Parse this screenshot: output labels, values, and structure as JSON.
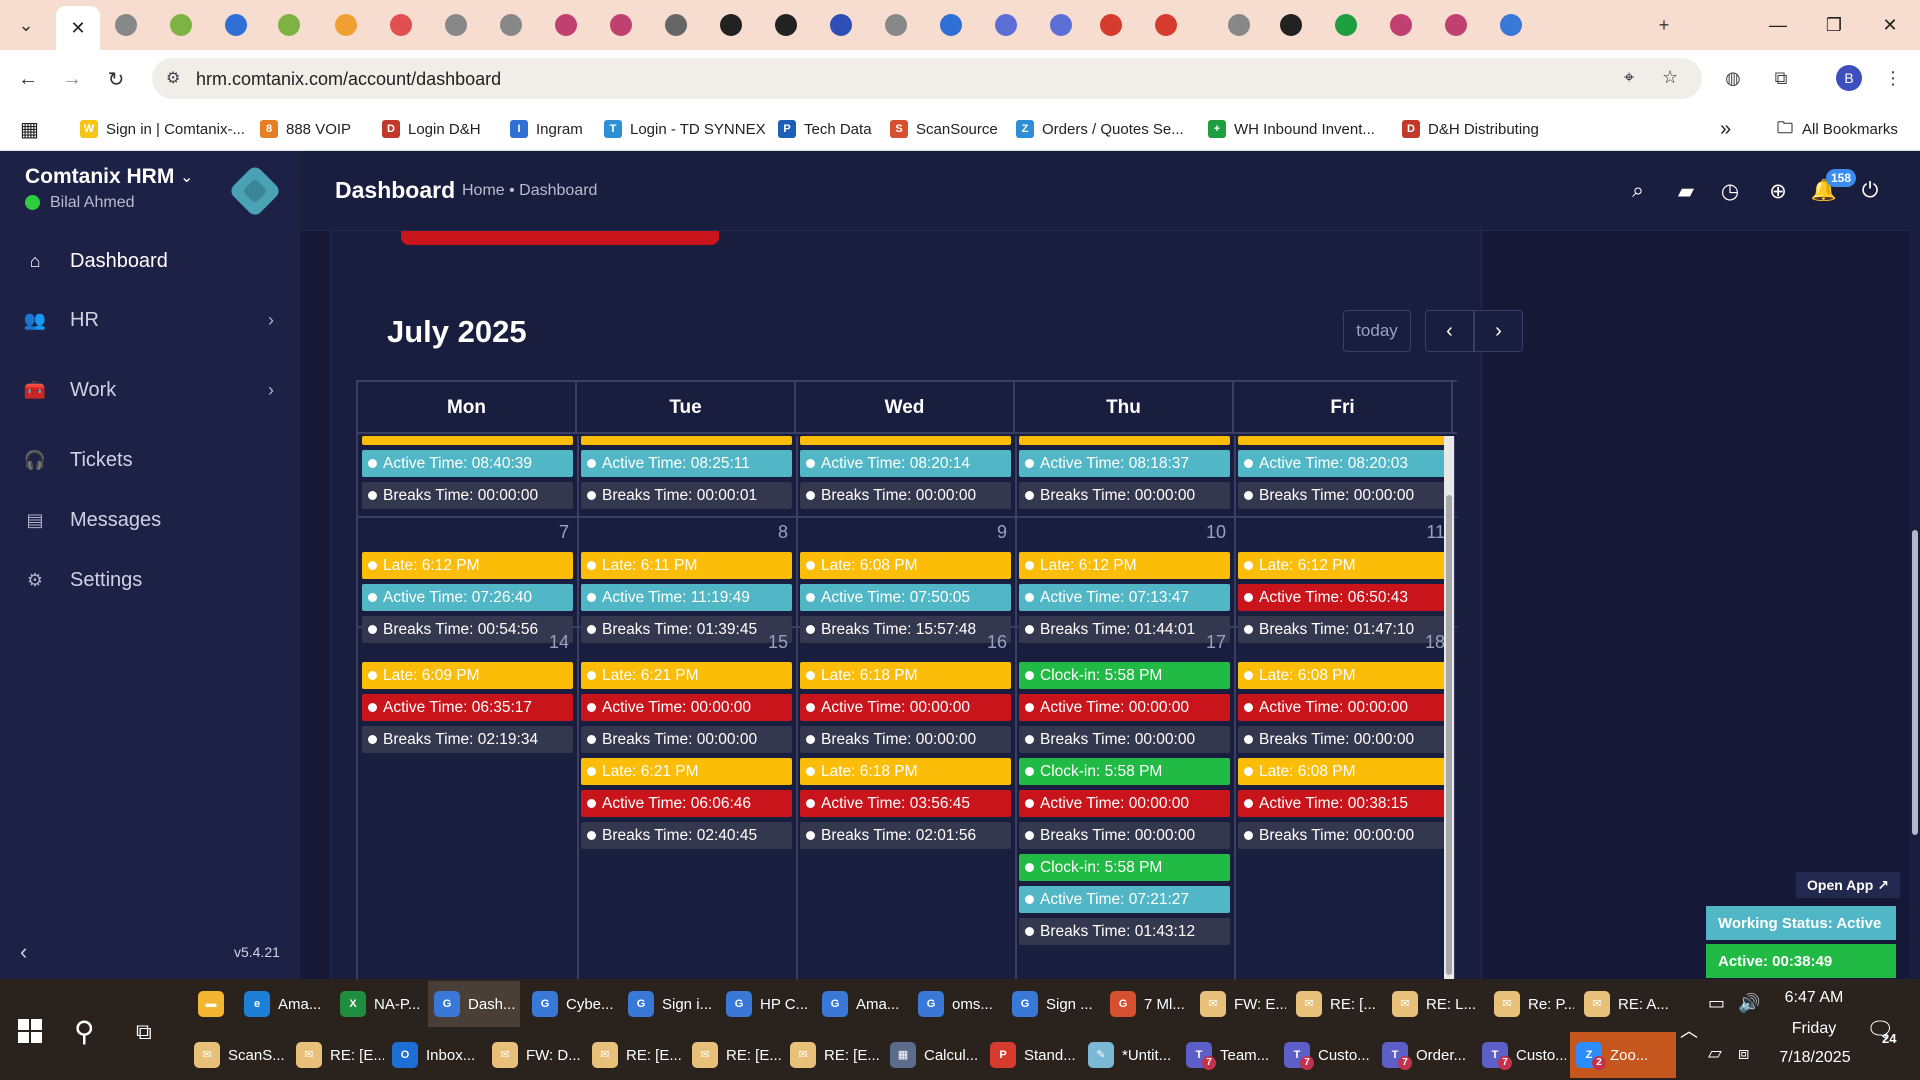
{
  "browser": {
    "url": "hrm.comtanix.com/account/dashboard",
    "tab_close": "✕",
    "new_tab": "+",
    "bookmarks": [
      {
        "label": "Sign in | Comtanix-...",
        "color": "#f5c518",
        "glyph": "W"
      },
      {
        "label": "888 VOIP",
        "color": "#e67e22",
        "glyph": "8"
      },
      {
        "label": "Login D&H",
        "color": "#c0392b",
        "glyph": "D"
      },
      {
        "label": "Ingram",
        "color": "#2f6fd6",
        "glyph": "I"
      },
      {
        "label": "Login - TD SYNNEX",
        "color": "#2f8fd6",
        "glyph": "T"
      },
      {
        "label": "Tech Data",
        "color": "#1b5fb8",
        "glyph": "P"
      },
      {
        "label": "ScanSource",
        "color": "#d64f2f",
        "glyph": "S"
      },
      {
        "label": "Orders / Quotes Se...",
        "color": "#2f8fd6",
        "glyph": "Z"
      },
      {
        "label": "WH Inbound Invent...",
        "color": "#1e9e3e",
        "glyph": "+"
      },
      {
        "label": "D&H Distributing",
        "color": "#c0392b",
        "glyph": "D"
      }
    ],
    "more_bookmarks": "»",
    "all_bookmarks": "All Bookmarks",
    "profile_initial": "B"
  },
  "app": {
    "brand": "Comtanix HRM",
    "user": "Bilal Ahmed",
    "nav": [
      {
        "label": "Dashboard",
        "icon": "⌂",
        "chevron": ""
      },
      {
        "label": "HR",
        "icon": "👥",
        "chevron": "›"
      },
      {
        "label": "Work",
        "icon": "🧰",
        "chevron": "›"
      },
      {
        "label": "Tickets",
        "icon": "🎧",
        "chevron": ""
      },
      {
        "label": "Messages",
        "icon": "▤",
        "chevron": ""
      },
      {
        "label": "Settings",
        "icon": "⚙",
        "chevron": ""
      }
    ],
    "version": "v5.4.21",
    "page_title": "Dashboard",
    "breadcrumb": "Home • Dashboard",
    "notification_count": "158"
  },
  "calendar": {
    "title": "July 2025",
    "today": "today",
    "prev": "‹",
    "next": "›",
    "days": [
      "Mon",
      "Tue",
      "Wed",
      "Thu",
      "Fri"
    ],
    "week1": {
      "events": [
        [
          {
            "t": "active",
            "text": "Active Time: 08:40:39"
          },
          {
            "t": "breaks",
            "text": "Breaks Time: 00:00:00"
          }
        ],
        [
          {
            "t": "active",
            "text": "Active Time: 08:25:11"
          },
          {
            "t": "breaks",
            "text": "Breaks Time: 00:00:01"
          }
        ],
        [
          {
            "t": "active",
            "text": "Active Time: 08:20:14"
          },
          {
            "t": "breaks",
            "text": "Breaks Time: 00:00:00"
          }
        ],
        [
          {
            "t": "active",
            "text": "Active Time: 08:18:37"
          },
          {
            "t": "breaks",
            "text": "Breaks Time: 00:00:00"
          }
        ],
        [
          {
            "t": "active",
            "text": "Active Time: 08:20:03"
          },
          {
            "t": "breaks",
            "text": "Breaks Time: 00:00:00"
          }
        ]
      ]
    },
    "week2": {
      "dates": [
        "7",
        "8",
        "9",
        "10",
        "11"
      ],
      "events": [
        [
          {
            "t": "late",
            "text": "Late: 6:12 PM"
          },
          {
            "t": "active",
            "text": "Active Time: 07:26:40"
          },
          {
            "t": "breaks",
            "text": "Breaks Time: 00:54:56"
          }
        ],
        [
          {
            "t": "late",
            "text": "Late: 6:11 PM"
          },
          {
            "t": "active",
            "text": "Active Time: 11:19:49"
          },
          {
            "t": "breaks",
            "text": "Breaks Time: 01:39:45"
          }
        ],
        [
          {
            "t": "late",
            "text": "Late: 6:08 PM"
          },
          {
            "t": "active",
            "text": "Active Time: 07:50:05"
          },
          {
            "t": "breaks",
            "text": "Breaks Time: 15:57:48"
          }
        ],
        [
          {
            "t": "late",
            "text": "Late: 6:12 PM"
          },
          {
            "t": "active",
            "text": "Active Time: 07:13:47"
          },
          {
            "t": "breaks",
            "text": "Breaks Time: 01:44:01"
          }
        ],
        [
          {
            "t": "late",
            "text": "Late: 6:12 PM"
          },
          {
            "t": "alert",
            "text": "Active Time: 06:50:43"
          },
          {
            "t": "breaks",
            "text": "Breaks Time: 01:47:10"
          }
        ]
      ]
    },
    "week3": {
      "dates": [
        "14",
        "15",
        "16",
        "17",
        "18"
      ],
      "events": [
        [
          {
            "t": "late",
            "text": "Late: 6:09 PM"
          },
          {
            "t": "alert",
            "text": "Active Time: 06:35:17"
          },
          {
            "t": "breaks",
            "text": "Breaks Time: 02:19:34"
          }
        ],
        [
          {
            "t": "late",
            "text": "Late: 6:21 PM"
          },
          {
            "t": "alert",
            "text": "Active Time: 00:00:00"
          },
          {
            "t": "breaks",
            "text": "Breaks Time: 00:00:00"
          },
          {
            "t": "late",
            "text": "Late: 6:21 PM"
          },
          {
            "t": "alert",
            "text": "Active Time: 06:06:46"
          },
          {
            "t": "breaks",
            "text": "Breaks Time: 02:40:45"
          }
        ],
        [
          {
            "t": "late",
            "text": "Late: 6:18 PM"
          },
          {
            "t": "alert",
            "text": "Active Time: 00:00:00"
          },
          {
            "t": "breaks",
            "text": "Breaks Time: 00:00:00"
          },
          {
            "t": "late",
            "text": "Late: 6:18 PM"
          },
          {
            "t": "alert",
            "text": "Active Time: 03:56:45"
          },
          {
            "t": "breaks",
            "text": "Breaks Time: 02:01:56"
          }
        ],
        [
          {
            "t": "clock",
            "text": "Clock-in: 5:58 PM"
          },
          {
            "t": "alert",
            "text": "Active Time: 00:00:00"
          },
          {
            "t": "breaks",
            "text": "Breaks Time: 00:00:00"
          },
          {
            "t": "clock",
            "text": "Clock-in: 5:58 PM"
          },
          {
            "t": "alert",
            "text": "Active Time: 00:00:00"
          },
          {
            "t": "breaks",
            "text": "Breaks Time: 00:00:00"
          },
          {
            "t": "clock",
            "text": "Clock-in: 5:58 PM"
          },
          {
            "t": "active",
            "text": "Active Time: 07:21:27"
          },
          {
            "t": "breaks",
            "text": "Breaks Time: 01:43:12"
          }
        ],
        [
          {
            "t": "late",
            "text": "Late: 6:08 PM"
          },
          {
            "t": "alert",
            "text": "Active Time: 00:00:00"
          },
          {
            "t": "breaks",
            "text": "Breaks Time: 00:00:00"
          },
          {
            "t": "late",
            "text": "Late: 6:08 PM"
          },
          {
            "t": "alert",
            "text": "Active Time: 00:38:15"
          },
          {
            "t": "breaks",
            "text": "Breaks Time: 00:00:00"
          }
        ]
      ]
    }
  },
  "status": {
    "open_app": "Open App ↗",
    "working": "Working Status: Active",
    "active": "Active: 00:38:49"
  },
  "taskbar": {
    "row1": [
      {
        "label": "",
        "color": "#f2b632",
        "glyph": "▬"
      },
      {
        "label": "Ama...",
        "color": "#1d7fd6",
        "glyph": "e"
      },
      {
        "label": "NA-P...",
        "color": "#1e8e3e",
        "glyph": "X"
      },
      {
        "label": "Dash...",
        "color": "#3a78d8",
        "glyph": "G"
      },
      {
        "label": "Cybe...",
        "color": "#3a78d8",
        "glyph": "G"
      },
      {
        "label": "Sign i...",
        "color": "#3a78d8",
        "glyph": "G"
      },
      {
        "label": "HP C...",
        "color": "#3a78d8",
        "glyph": "G"
      },
      {
        "label": "Ama...",
        "color": "#3a78d8",
        "glyph": "G"
      },
      {
        "label": "oms...",
        "color": "#3a78d8",
        "glyph": "G"
      },
      {
        "label": "Sign ...",
        "color": "#3a78d8",
        "glyph": "G"
      },
      {
        "label": "7 Ml...",
        "color": "#d64f2f",
        "glyph": "G"
      },
      {
        "label": "FW: E...",
        "color": "#e8c07a",
        "glyph": "✉"
      },
      {
        "label": "RE: [...",
        "color": "#e8c07a",
        "glyph": "✉"
      },
      {
        "label": "RE: L...",
        "color": "#e8c07a",
        "glyph": "✉"
      },
      {
        "label": "Re: P...",
        "color": "#e8c07a",
        "glyph": "✉"
      },
      {
        "label": "RE: A...",
        "color": "#e8c07a",
        "glyph": "✉"
      }
    ],
    "row2": [
      {
        "label": "ScanS...",
        "color": "#e8c07a",
        "glyph": "✉"
      },
      {
        "label": "RE: [E...",
        "color": "#e8c07a",
        "glyph": "✉"
      },
      {
        "label": "Inbox...",
        "color": "#1d6fd6",
        "glyph": "O"
      },
      {
        "label": "FW: D...",
        "color": "#e8c07a",
        "glyph": "✉"
      },
      {
        "label": "RE: [E...",
        "color": "#e8c07a",
        "glyph": "✉"
      },
      {
        "label": "RE: [E...",
        "color": "#e8c07a",
        "glyph": "✉"
      },
      {
        "label": "RE: [E...",
        "color": "#e8c07a",
        "glyph": "✉"
      },
      {
        "label": "Calcul...",
        "color": "#5b6b8c",
        "glyph": "▦"
      },
      {
        "label": "Stand...",
        "color": "#d63b2f",
        "glyph": "P"
      },
      {
        "label": "*Untit...",
        "color": "#7ab8d6",
        "glyph": "✎"
      },
      {
        "label": "Team...",
        "color": "#5b5fc7",
        "glyph": "T"
      },
      {
        "label": "Custo...",
        "color": "#5b5fc7",
        "glyph": "T"
      },
      {
        "label": "Order...",
        "color": "#5b5fc7",
        "glyph": "T"
      },
      {
        "label": "Custo...",
        "color": "#5b5fc7",
        "glyph": "T"
      },
      {
        "label": "Zoo...",
        "color": "#2d8cff",
        "glyph": "Z"
      }
    ],
    "clock_time": "6:47 AM",
    "clock_day": "Friday",
    "clock_date": "7/18/2025",
    "notifications": "24",
    "badge_teams": "7",
    "badge_zoom": "2"
  }
}
